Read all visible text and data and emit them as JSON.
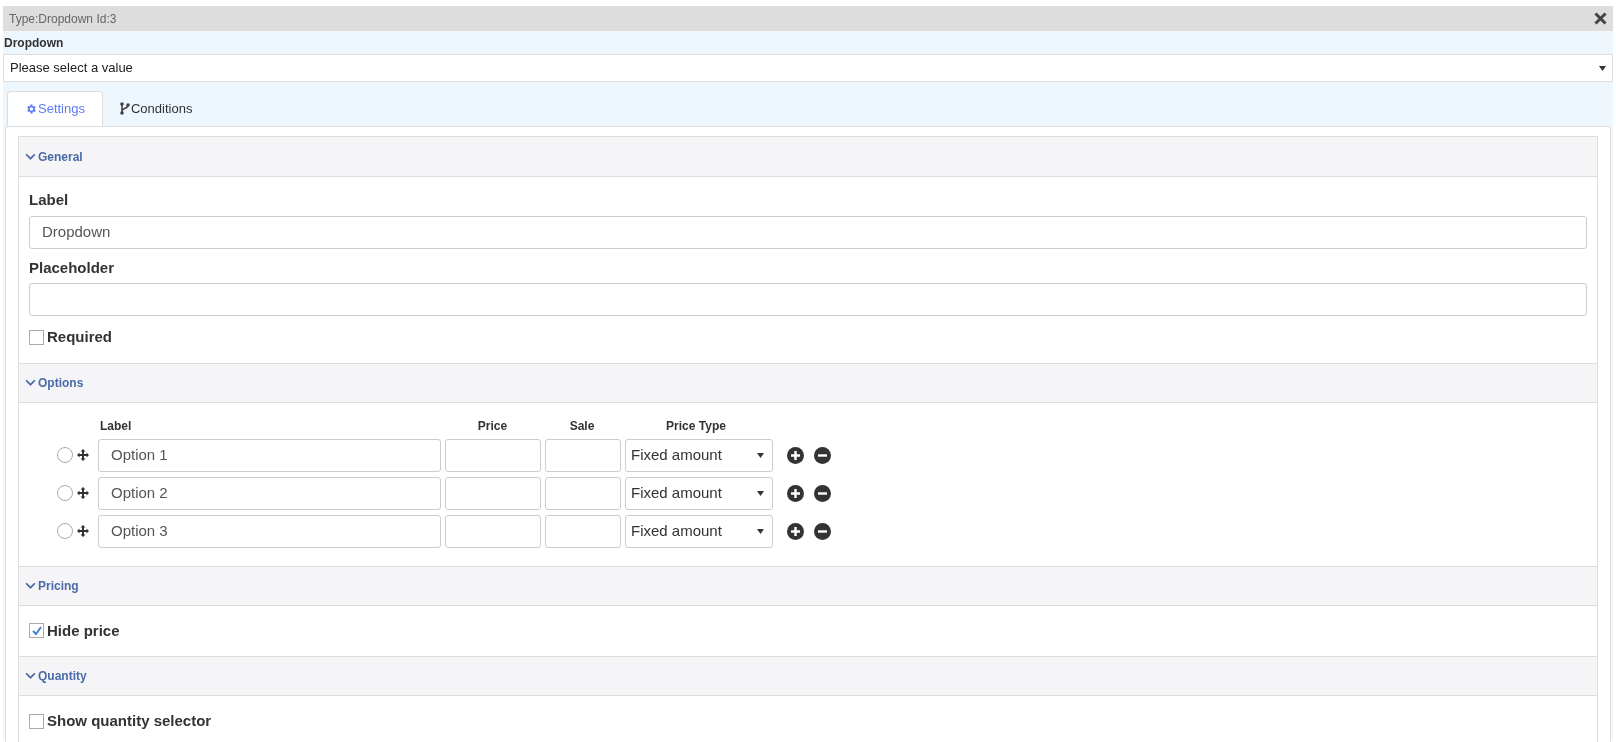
{
  "window": {
    "title": "Type:Dropdown Id:3"
  },
  "preview": {
    "label": "Dropdown",
    "value": "Please select a value"
  },
  "tabs": [
    {
      "kind": "settings",
      "label": "Settings",
      "selected": true
    },
    {
      "kind": "conditions",
      "label": "Conditions",
      "selected": false
    }
  ],
  "sections": [
    {
      "kind": "fields",
      "title": "General",
      "expanded": true,
      "fields": [
        {
          "kind": "text",
          "label": "Label",
          "value": "Dropdown"
        },
        {
          "kind": "text",
          "label": "Placeholder"
        },
        {
          "kind": "checkbox",
          "label": "Required",
          "checked": false
        }
      ]
    },
    {
      "kind": "options",
      "title": "Options",
      "expanded": true,
      "columns": [
        "Label",
        "Price",
        "Sale",
        "Price Type"
      ],
      "rows": [
        {
          "label": "Option 1",
          "price_type": "Fixed amount",
          "selected": false
        },
        {
          "label": "Option 2",
          "price_type": "Fixed amount",
          "selected": false
        },
        {
          "label": "Option 3",
          "price_type": "Fixed amount",
          "selected": false
        }
      ]
    },
    {
      "kind": "fields",
      "title": "Pricing",
      "expanded": true,
      "fields": [
        {
          "kind": "checkbox",
          "label": "Hide price",
          "checked": true
        }
      ]
    },
    {
      "kind": "fields",
      "title": "Quantity",
      "expanded": true,
      "fields": [
        {
          "kind": "checkbox",
          "label": "Show quantity selector",
          "checked": false
        }
      ]
    }
  ]
}
